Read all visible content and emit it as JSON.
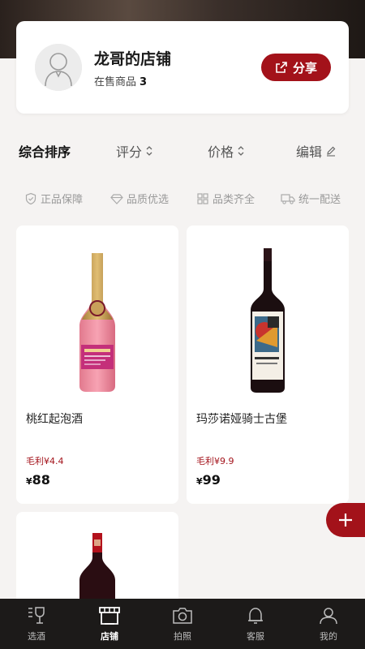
{
  "shop": {
    "name": "龙哥的店铺",
    "count_label": "在售商品",
    "count": "3",
    "share_label": "分享"
  },
  "sort": {
    "items": [
      {
        "label": "综合排序"
      },
      {
        "label": "评分"
      },
      {
        "label": "价格"
      },
      {
        "label": "编辑"
      }
    ]
  },
  "features": [
    {
      "label": "正品保障",
      "icon": "shield-check-icon"
    },
    {
      "label": "品质优选",
      "icon": "diamond-icon"
    },
    {
      "label": "品类齐全",
      "icon": "grid-icon"
    },
    {
      "label": "统一配送",
      "icon": "truck-icon"
    }
  ],
  "products": [
    {
      "name": "桃红起泡酒",
      "profit": "毛利¥4.4",
      "currency": "¥",
      "price": "88"
    },
    {
      "name": "玛莎诺娅骑士古堡",
      "profit": "毛利¥9.9",
      "currency": "¥",
      "price": "99"
    }
  ],
  "tabs": [
    {
      "label": "选酒",
      "icon": "wine-glass-icon"
    },
    {
      "label": "店铺",
      "icon": "store-icon"
    },
    {
      "label": "拍照",
      "icon": "camera-icon"
    },
    {
      "label": "客服",
      "icon": "bell-icon"
    },
    {
      "label": "我的",
      "icon": "user-icon"
    }
  ],
  "colors": {
    "accent": "#a3121a",
    "tabbar_bg": "#1c1a19",
    "page_bg": "#f5f3f2"
  }
}
